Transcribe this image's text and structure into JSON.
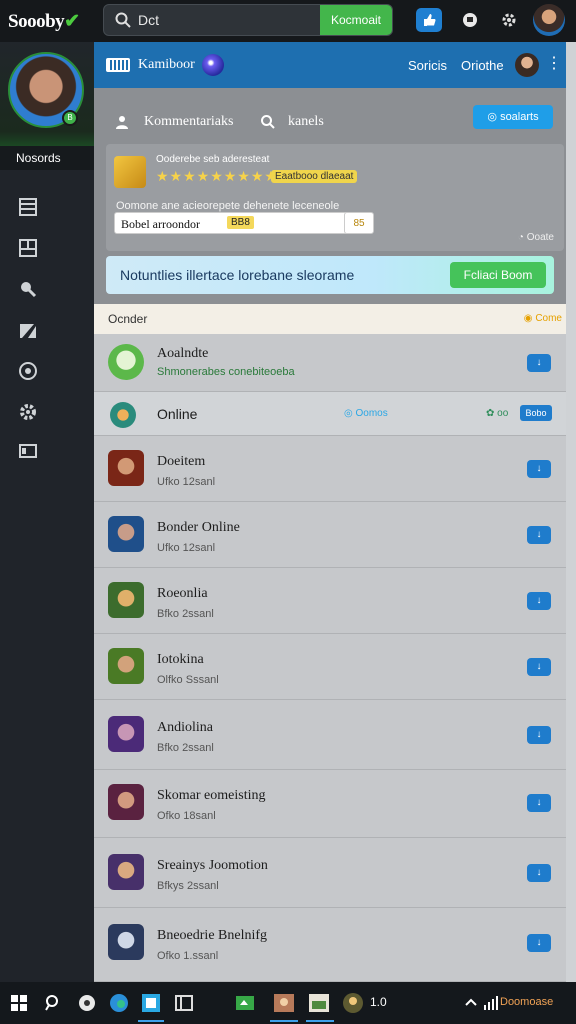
{
  "topbar": {
    "brand": "Soooby",
    "search_value": "Dct",
    "search_button": "Kocmoait"
  },
  "sidebar": {
    "profile_badge": "B",
    "profile_name": "Nosords"
  },
  "main_header": {
    "title": "Kamiboor",
    "link1": "Soricis",
    "link2": "Oriothe"
  },
  "tabs": [
    {
      "label": "Kommentariaks"
    },
    {
      "label": "kanels"
    }
  ],
  "header_button": "soalarts",
  "card": {
    "top_text": "Ooderebe seb aderesteat",
    "stars": "★★★★★★★★★",
    "chip": "Eaatbooo dlaeaat",
    "description": "Oomone ane acieorepete dehenete leceneole",
    "input_value": "Bobel arroondor",
    "input_chip": "BB8",
    "count": "85",
    "footer": "Ooate"
  },
  "banner": {
    "text": "Notuntlies illertace lorebane sleorame",
    "button": "Fcliaci Boom"
  },
  "order": {
    "label": "Ocnder",
    "right": "Come"
  },
  "rows_top": {
    "title": "Aoalndte",
    "subtitle": "Shmonerabes conebiteoeba"
  },
  "online": {
    "label": "Online",
    "mid": "Oomos",
    "right1": "oo",
    "right2": "Bobo"
  },
  "rows": [
    {
      "title": "Doeitem",
      "subtitle": "Ufko  12sanl"
    },
    {
      "title": "Bonder Online",
      "subtitle": "Ufko  12sanl"
    },
    {
      "title": "Roeonlia",
      "subtitle": "Bfko  2ssanl"
    },
    {
      "title": "Iotokina",
      "subtitle": "Olfko  Sssanl"
    },
    {
      "title": "Andiolina",
      "subtitle": "Bfko  2ssanl"
    },
    {
      "title": "Skomar eomeisting",
      "subtitle": "Ofko  18sanl"
    },
    {
      "title": "Sreainys Joomotion",
      "subtitle": "Bfkys  2ssanl"
    },
    {
      "title": "Bneoedrie Bnelnifg",
      "subtitle": "Ofko  1.ssanl"
    }
  ],
  "taskbar": {
    "time": "1.0",
    "tray": "Doomoase"
  },
  "colors": {
    "accent_green": "#43b64b",
    "accent_blue": "#1f7fd1",
    "header_blue": "#1e6fb0"
  }
}
